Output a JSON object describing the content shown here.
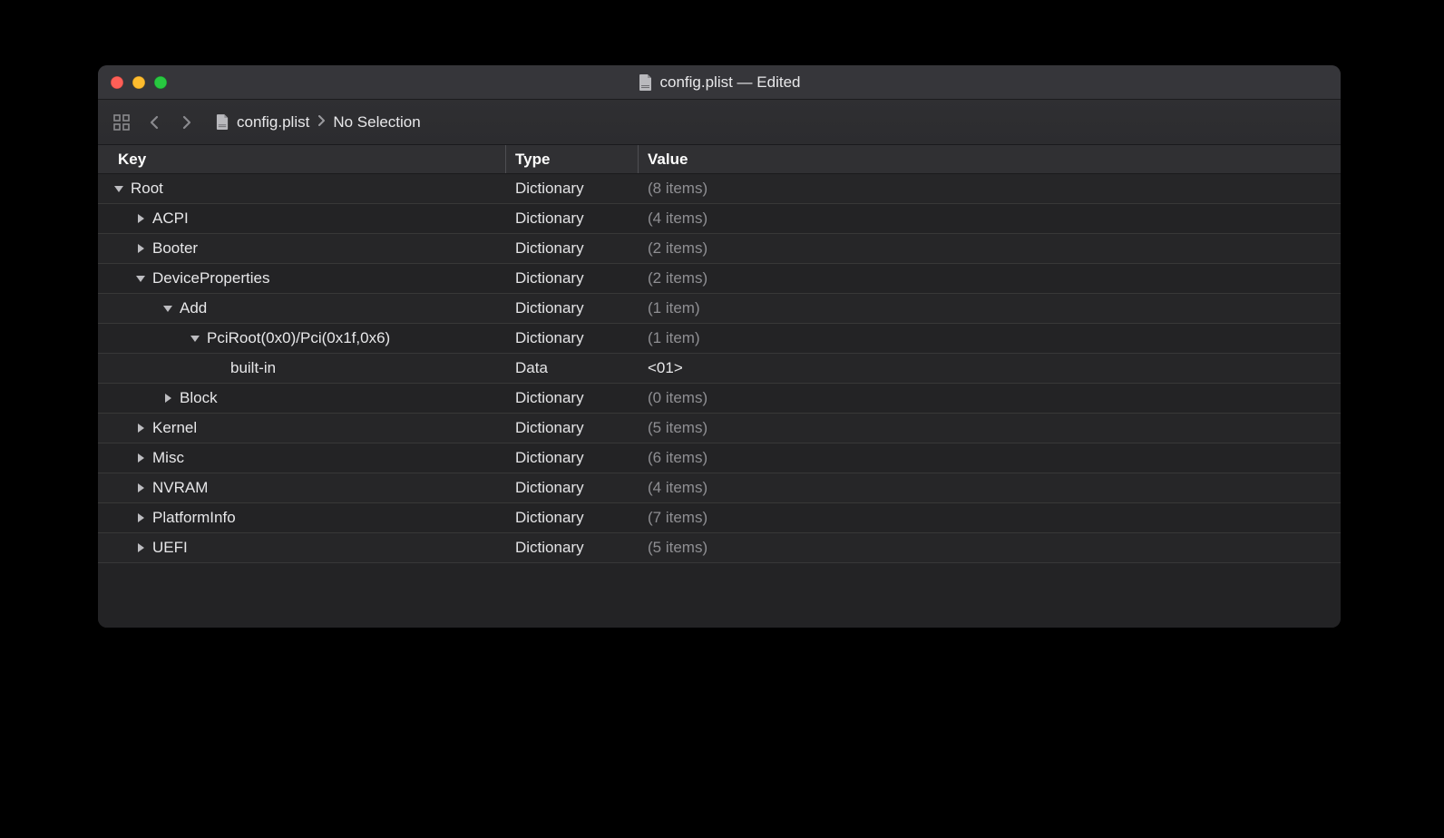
{
  "window": {
    "title": "config.plist — Edited",
    "file_icon": "plist-file-icon"
  },
  "toolbar": {
    "view_mode": "grid-icon",
    "nav_back": "chevron-left",
    "nav_forward": "chevron-right"
  },
  "breadcrumb": {
    "file": "config.plist",
    "selection": "No Selection"
  },
  "columns": {
    "key": "Key",
    "type": "Type",
    "value": "Value"
  },
  "rows": [
    {
      "indent": 0,
      "expanded": true,
      "key": "Root",
      "type": "Dictionary",
      "value": "(8 items)",
      "dim": true
    },
    {
      "indent": 1,
      "expanded": false,
      "key": "ACPI",
      "type": "Dictionary",
      "value": "(4 items)",
      "dim": true
    },
    {
      "indent": 1,
      "expanded": false,
      "key": "Booter",
      "type": "Dictionary",
      "value": "(2 items)",
      "dim": true
    },
    {
      "indent": 1,
      "expanded": true,
      "key": "DeviceProperties",
      "type": "Dictionary",
      "value": "(2 items)",
      "dim": true
    },
    {
      "indent": 2,
      "expanded": true,
      "key": "Add",
      "type": "Dictionary",
      "value": "(1 item)",
      "dim": true
    },
    {
      "indent": 3,
      "expanded": true,
      "key": "PciRoot(0x0)/Pci(0x1f,0x6)",
      "type": "Dictionary",
      "value": "(1 item)",
      "dim": true
    },
    {
      "indent": 4,
      "expanded": null,
      "key": "built-in",
      "type": "Data",
      "value": "<01>",
      "dim": false
    },
    {
      "indent": 2,
      "expanded": false,
      "key": "Block",
      "type": "Dictionary",
      "value": "(0 items)",
      "dim": true
    },
    {
      "indent": 1,
      "expanded": false,
      "key": "Kernel",
      "type": "Dictionary",
      "value": "(5 items)",
      "dim": true
    },
    {
      "indent": 1,
      "expanded": false,
      "key": "Misc",
      "type": "Dictionary",
      "value": "(6 items)",
      "dim": true
    },
    {
      "indent": 1,
      "expanded": false,
      "key": "NVRAM",
      "type": "Dictionary",
      "value": "(4 items)",
      "dim": true
    },
    {
      "indent": 1,
      "expanded": false,
      "key": "PlatformInfo",
      "type": "Dictionary",
      "value": "(7 items)",
      "dim": true
    },
    {
      "indent": 1,
      "expanded": false,
      "key": "UEFI",
      "type": "Dictionary",
      "value": "(5 items)",
      "dim": true
    }
  ]
}
